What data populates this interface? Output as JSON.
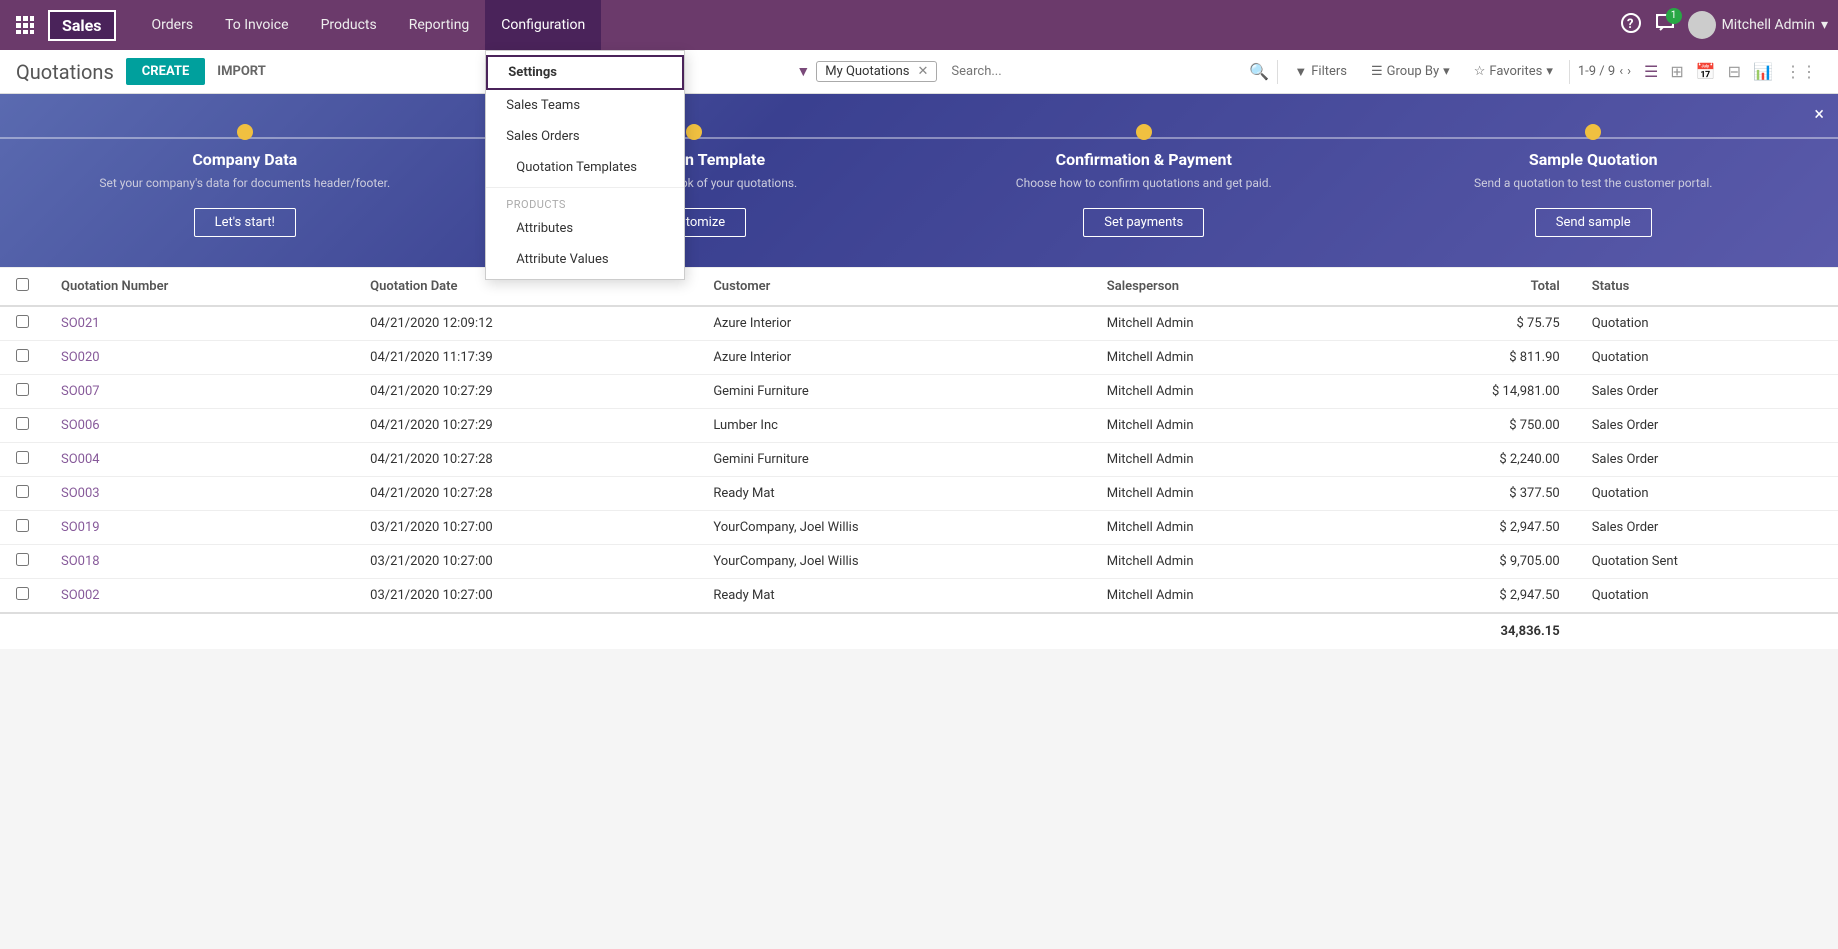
{
  "app": {
    "name": "Sales",
    "grid_icon": "⊞"
  },
  "topnav": {
    "menu_items": [
      {
        "label": "Orders",
        "active": false
      },
      {
        "label": "To Invoice",
        "active": false
      },
      {
        "label": "Products",
        "active": false
      },
      {
        "label": "Reporting",
        "active": false
      },
      {
        "label": "Configuration",
        "active": true
      }
    ],
    "right": {
      "help_icon": "?",
      "chat_icon": "💬",
      "chat_badge": "1",
      "user_name": "Mitchell Admin",
      "user_avatar": "👤",
      "dropdown_arrow": "▾"
    }
  },
  "config_dropdown": {
    "items": [
      {
        "label": "Settings",
        "selected": true
      },
      {
        "label": "Sales Teams",
        "selected": false
      },
      {
        "label": "Sales Orders",
        "selected": false
      },
      {
        "label": "Quotation Templates",
        "selected": false
      },
      {
        "label": "Products",
        "section": true
      },
      {
        "label": "Attributes",
        "selected": false
      },
      {
        "label": "Attribute Values",
        "selected": false
      }
    ]
  },
  "subheader": {
    "page_title": "Quotations",
    "create_label": "CREATE",
    "import_label": "IMPORT"
  },
  "filter_bar": {
    "filter_label": "Filters",
    "groupby_label": "Group By",
    "favorites_label": "Favorites",
    "active_filter": "My Quotations",
    "search_placeholder": "Search...",
    "pagination": "1-9 / 9"
  },
  "banner": {
    "close_icon": "×",
    "steps": [
      {
        "title": "Company Data",
        "desc": "Set your company's data for documents header/footer.",
        "btn_label": "Let's start!"
      },
      {
        "title": "Quotation Template",
        "desc": "Customize the look of your quotations.",
        "btn_label": "Customize"
      },
      {
        "title": "Confirmation & Payment",
        "desc": "Choose how to confirm quotations and get paid.",
        "btn_label": "Set payments"
      },
      {
        "title": "Sample Quotation",
        "desc": "Send a quotation to test the customer portal.",
        "btn_label": "Send sample"
      }
    ]
  },
  "table": {
    "headers": [
      {
        "label": "Quotation Number"
      },
      {
        "label": "Quotation Date"
      },
      {
        "label": "Customer"
      },
      {
        "label": "Salesperson"
      },
      {
        "label": "Total"
      },
      {
        "label": "Status"
      }
    ],
    "rows": [
      {
        "number": "SO021",
        "date": "04/21/2020 12:09:12",
        "customer": "Azure Interior",
        "salesperson": "Mitchell Admin",
        "total": "$ 75.75",
        "status": "Quotation"
      },
      {
        "number": "SO020",
        "date": "04/21/2020 11:17:39",
        "customer": "Azure Interior",
        "salesperson": "Mitchell Admin",
        "total": "$ 811.90",
        "status": "Quotation"
      },
      {
        "number": "SO007",
        "date": "04/21/2020 10:27:29",
        "customer": "Gemini Furniture",
        "salesperson": "Mitchell Admin",
        "total": "$ 14,981.00",
        "status": "Sales Order"
      },
      {
        "number": "SO006",
        "date": "04/21/2020 10:27:29",
        "customer": "Lumber Inc",
        "salesperson": "Mitchell Admin",
        "total": "$ 750.00",
        "status": "Sales Order"
      },
      {
        "number": "SO004",
        "date": "04/21/2020 10:27:28",
        "customer": "Gemini Furniture",
        "salesperson": "Mitchell Admin",
        "total": "$ 2,240.00",
        "status": "Sales Order"
      },
      {
        "number": "SO003",
        "date": "04/21/2020 10:27:28",
        "customer": "Ready Mat",
        "salesperson": "Mitchell Admin",
        "total": "$ 377.50",
        "status": "Quotation"
      },
      {
        "number": "SO019",
        "date": "03/21/2020 10:27:00",
        "customer": "YourCompany, Joel Willis",
        "salesperson": "Mitchell Admin",
        "total": "$ 2,947.50",
        "status": "Sales Order"
      },
      {
        "number": "SO018",
        "date": "03/21/2020 10:27:00",
        "customer": "YourCompany, Joel Willis",
        "salesperson": "Mitchell Admin",
        "total": "$ 9,705.00",
        "status": "Quotation Sent"
      },
      {
        "number": "SO002",
        "date": "03/21/2020 10:27:00",
        "customer": "Ready Mat",
        "salesperson": "Mitchell Admin",
        "total": "$ 2,947.50",
        "status": "Quotation"
      }
    ],
    "total_label": "34,836.15"
  }
}
